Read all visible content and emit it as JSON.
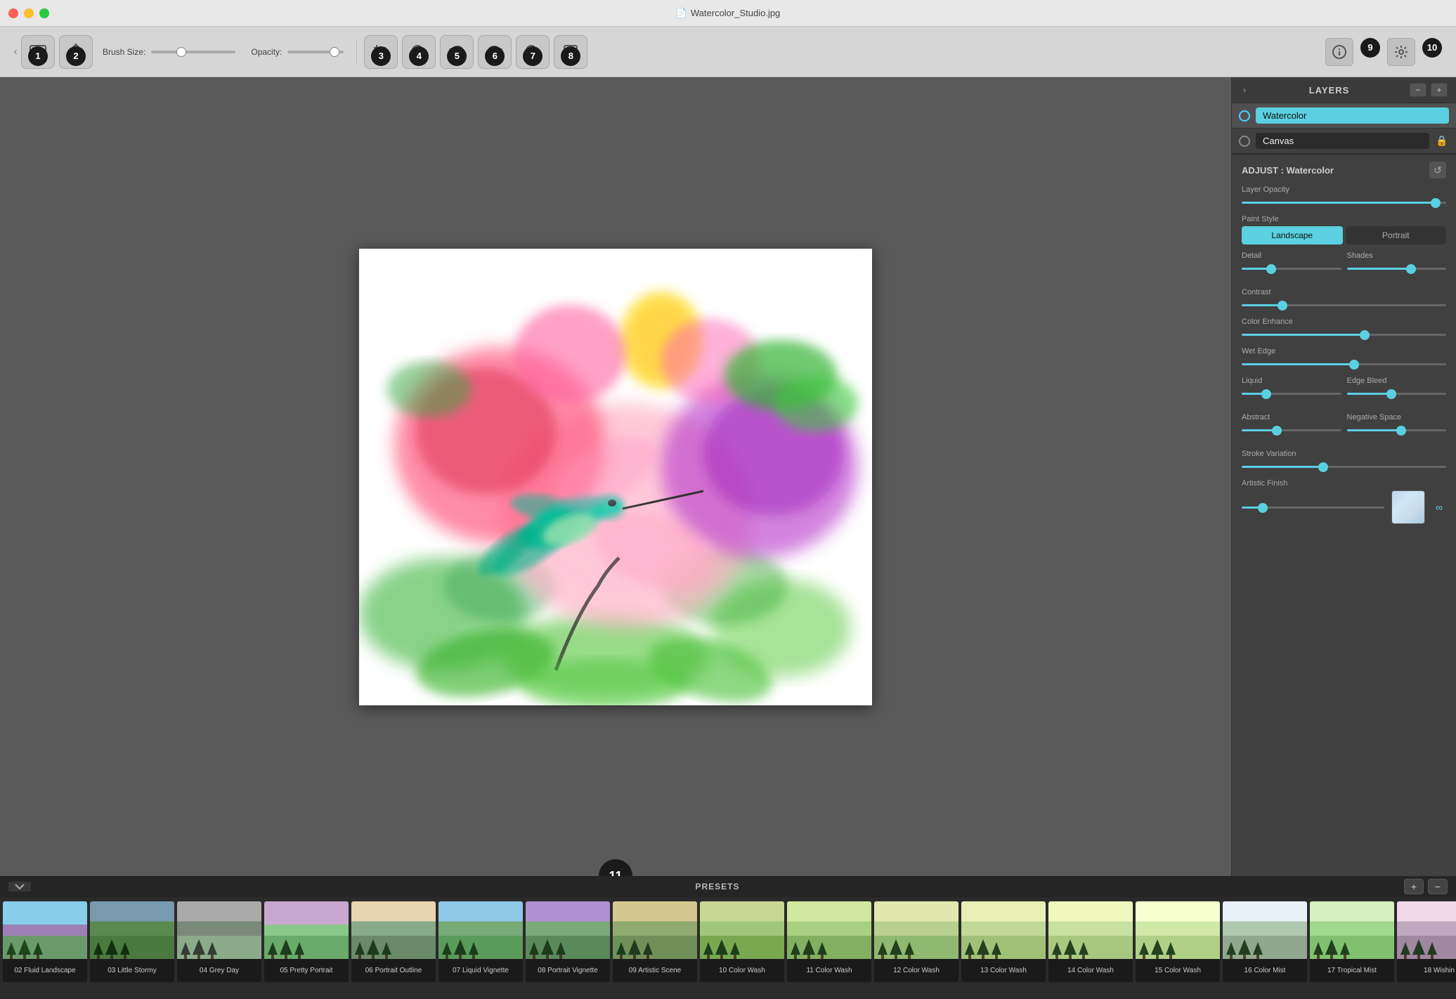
{
  "titlebar": {
    "title": "Watercolor_Studio.jpg",
    "icon": "📄"
  },
  "toolbar": {
    "buttons": [
      {
        "id": "1",
        "label": "gallery",
        "icon": "⊞"
      },
      {
        "id": "2",
        "label": "share",
        "icon": "⬆"
      },
      {
        "id": "3",
        "label": "crop",
        "icon": "⊡"
      },
      {
        "id": "4",
        "label": "zoom-in",
        "icon": "⊕"
      },
      {
        "id": "5",
        "label": "undo",
        "icon": "↩"
      },
      {
        "id": "6",
        "label": "redo",
        "icon": "↪"
      },
      {
        "id": "7",
        "label": "zoom-out",
        "icon": "⊖"
      },
      {
        "id": "8",
        "label": "fit",
        "icon": "⊠"
      }
    ],
    "brush_size_label": "Brush Size:",
    "opacity_label": "Opacity:",
    "brush_size_value": 40,
    "opacity_value": 100,
    "info_btn": "9",
    "settings_btn": "10"
  },
  "layers": {
    "title": "LAYERS",
    "items": [
      {
        "name": "Watercolor",
        "active": true,
        "dot": "blue"
      },
      {
        "name": "Canvas",
        "active": false,
        "dot": "inactive",
        "locked": true
      }
    ]
  },
  "adjust": {
    "title": "ADJUST : Watercolor",
    "controls": {
      "layer_opacity": {
        "label": "Layer Opacity",
        "value": 95
      },
      "paint_style": {
        "label": "Paint Style",
        "options": [
          "Landscape",
          "Portrait"
        ],
        "active": "Landscape"
      },
      "detail": {
        "label": "Detail",
        "value": 30
      },
      "shades": {
        "label": "Shades",
        "value": 65
      },
      "contrast": {
        "label": "Contrast",
        "value": 20
      },
      "color_enhance": {
        "label": "Color Enhance",
        "value": 60
      },
      "wet_edge": {
        "label": "Wet Edge",
        "value": 55
      },
      "liquid": {
        "label": "Liquid",
        "value": 25
      },
      "edge_bleed": {
        "label": "Edge Bleed",
        "value": 45
      },
      "abstract": {
        "label": "Abstract",
        "value": 35
      },
      "negative_space": {
        "label": "Negative Space",
        "value": 55
      },
      "stroke_variation": {
        "label": "Stroke Variation",
        "value": 40
      },
      "artistic_finish": {
        "label": "Artistic Finish",
        "value": 15
      }
    }
  },
  "presets": {
    "title": "PRESETS",
    "items": [
      {
        "id": "02",
        "name": "02 Fluid Landscape",
        "thumb": "lavender"
      },
      {
        "id": "03",
        "name": "03 Little Stormy",
        "thumb": "stormy"
      },
      {
        "id": "04",
        "name": "04 Grey Day",
        "thumb": "grey"
      },
      {
        "id": "05",
        "name": "05 Pretty Portrait",
        "thumb": "portrait"
      },
      {
        "id": "06",
        "name": "06 Portrait Outline",
        "thumb": "outline"
      },
      {
        "id": "07",
        "name": "07 Liquid Vignette",
        "thumb": "liquid"
      },
      {
        "id": "08",
        "name": "08 Portrait Vignette",
        "thumb": "p-vignette"
      },
      {
        "id": "09",
        "name": "09 Artistic Scene",
        "thumb": "artistic"
      },
      {
        "id": "10",
        "name": "10 Color Wash",
        "thumb": "colorwash"
      },
      {
        "id": "11",
        "name": "11 Color Wash",
        "thumb": "colorwash2"
      },
      {
        "id": "12",
        "name": "12 Color Wash",
        "thumb": "colorwash3"
      },
      {
        "id": "13",
        "name": "13 Color Wash",
        "thumb": "colorwash4"
      },
      {
        "id": "14",
        "name": "14 Color Wash",
        "thumb": "colorwash5"
      },
      {
        "id": "15",
        "name": "15 Color Wash",
        "thumb": "colorwash6"
      },
      {
        "id": "16",
        "name": "16 Color Mist",
        "thumb": "mist"
      },
      {
        "id": "17",
        "name": "17 Tropical Mist",
        "thumb": "tropical"
      },
      {
        "id": "18",
        "name": "18 Wishin",
        "thumb": "wishing"
      }
    ],
    "add_btn": "+",
    "remove_btn": "−"
  },
  "expand_btn": "11",
  "colors": {
    "accent": "#5ad0e0",
    "dark_bg": "#2a2a2a",
    "panel_bg": "#404040"
  }
}
